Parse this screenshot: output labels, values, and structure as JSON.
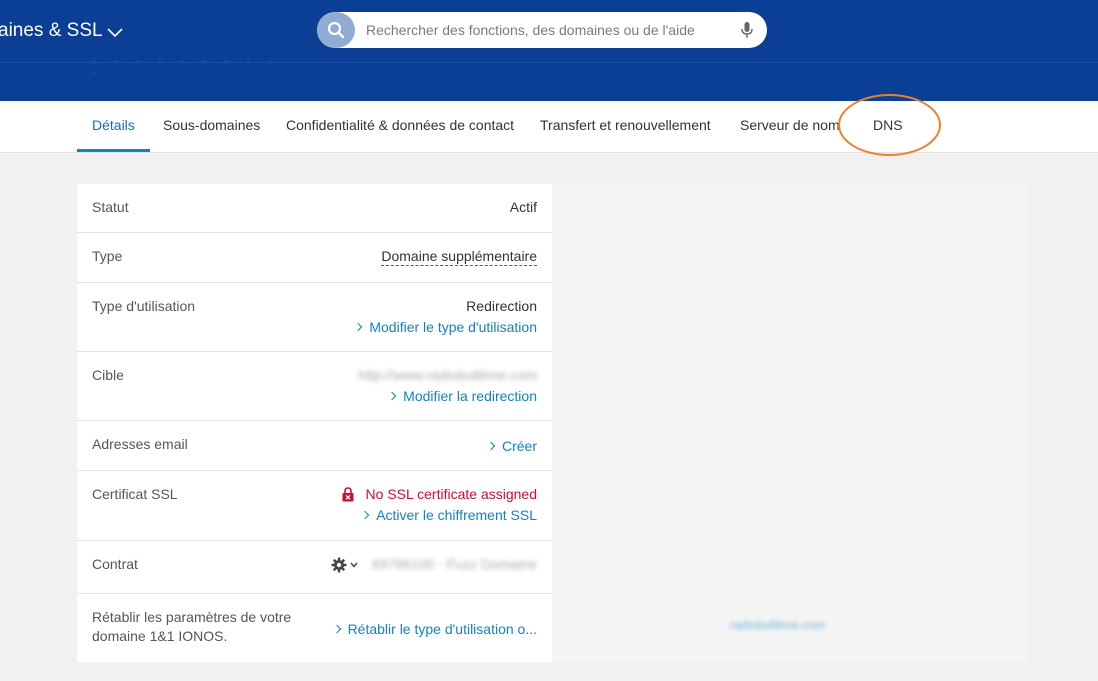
{
  "header": {
    "title": "aines & SSL",
    "subtitle_blurred": "· · · · · · · · · ·",
    "search": {
      "placeholder": "Rechercher des fonctions, des domaines ou de l'aide"
    }
  },
  "tabs": [
    {
      "label": "Détails",
      "active": true
    },
    {
      "label": "Sous-domaines"
    },
    {
      "label": "Confidentialité & données de contact"
    },
    {
      "label": "Transfert et renouvellement"
    },
    {
      "label": "Serveur de nom"
    },
    {
      "label": "DNS"
    }
  ],
  "details": {
    "statut": {
      "label": "Statut",
      "value": "Actif"
    },
    "type": {
      "label": "Type",
      "value": "Domaine supplémentaire"
    },
    "usage": {
      "label": "Type d'utilisation",
      "value": "Redirection",
      "link": "Modifier le type d'utilisation"
    },
    "cible": {
      "label": "Cible",
      "value": "http://www.radiobullême.com",
      "link": "Modifier la redirection"
    },
    "email": {
      "label": "Adresses email",
      "link": "Créer"
    },
    "ssl": {
      "label": "Certificat SSL",
      "value": "No SSL certificate assigned",
      "link": "Activer le chiffrement SSL"
    },
    "contrat": {
      "label": "Contrat",
      "value": "69786100 - Fuzz Domaine"
    },
    "reset": {
      "label_line1": "Rétablir les paramètres de votre",
      "label_line2": "domaine 1&1 IONOS.",
      "link": "Rétablir le type d'utilisation o..."
    }
  },
  "preview": {
    "link": "radiobullême.com"
  },
  "colors": {
    "header": "#0b3f96",
    "accent": "#1582c0",
    "error": "#c8102e",
    "highlight": "#f07e2b"
  }
}
